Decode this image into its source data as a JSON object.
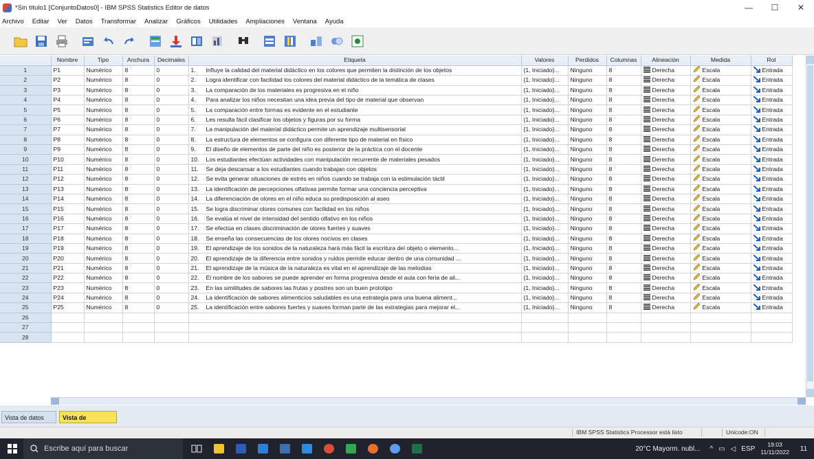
{
  "window": {
    "title": "*Sin título1 [ConjuntoDatos0] - IBM SPSS Statistics Editor de datos",
    "minimize": "—",
    "maximize": "☐",
    "close": "✕"
  },
  "menu": [
    "Archivo",
    "Editar",
    "Ver",
    "Datos",
    "Transformar",
    "Analizar",
    "Gráficos",
    "Utilidades",
    "Ampliaciones",
    "Ventana",
    "Ayuda"
  ],
  "toolbar": {
    "icons": [
      "open-folder-icon",
      "save-icon",
      "print-icon",
      "dialog-recall-icon",
      "undo-icon",
      "redo-icon",
      "goto-case-icon",
      "goto-variable-icon",
      "variables-icon",
      "run-descriptives-icon",
      "find-icon",
      "insert-cases-icon",
      "insert-variable-icon",
      "split-file-icon",
      "weight-cases-icon",
      "select-cases-icon",
      "value-labels-icon"
    ]
  },
  "grid": {
    "headers": [
      "Nombre",
      "Tipo",
      "Anchura",
      "Decimales",
      "Etiqueta",
      "Valores",
      "Perdidos",
      "Columnas",
      "Alineación",
      "Medida",
      "Rol"
    ],
    "rows": [
      {
        "n": "1",
        "nombre": "P1",
        "tipo": "Numérico",
        "anchura": "8",
        "decimales": "0",
        "num": "1.",
        "etiqueta": "Influye la calidad del material didáctico en los colores que permiten la distinción de los objetos",
        "valores": "{1, Iniciado}...",
        "perdidos": "Ninguno",
        "columnas": "8",
        "alineacion": "Derecha",
        "medida": "Escala",
        "rol": "Entrada"
      },
      {
        "n": "2",
        "nombre": "P2",
        "tipo": "Numérico",
        "anchura": "8",
        "decimales": "0",
        "num": "2.",
        "etiqueta": "Logra identificar con facilidad los colores del material didáctico de la temática de clases",
        "valores": "{1, Iniciado}...",
        "perdidos": "Ninguno",
        "columnas": "8",
        "alineacion": "Derecha",
        "medida": "Escala",
        "rol": "Entrada"
      },
      {
        "n": "3",
        "nombre": "P3",
        "tipo": "Numérico",
        "anchura": "8",
        "decimales": "0",
        "num": "3.",
        "etiqueta": "La comparación de los materiales es progresiva en el niño",
        "valores": "{1, Iniciado}...",
        "perdidos": "Ninguno",
        "columnas": "8",
        "alineacion": "Derecha",
        "medida": "Escala",
        "rol": "Entrada"
      },
      {
        "n": "4",
        "nombre": "P4",
        "tipo": "Numérico",
        "anchura": "8",
        "decimales": "0",
        "num": "4.",
        "etiqueta": "Para analizar los niños necesitan una idea previa del tipo de material que observan",
        "valores": "{1, Iniciado}...",
        "perdidos": "Ninguno",
        "columnas": "8",
        "alineacion": "Derecha",
        "medida": "Escala",
        "rol": "Entrada"
      },
      {
        "n": "5",
        "nombre": "P5",
        "tipo": "Numérico",
        "anchura": "8",
        "decimales": "0",
        "num": "5.",
        "etiqueta": "La comparación entre formas es evidente en el estudiante",
        "valores": "{1, Iniciado}...",
        "perdidos": "Ninguno",
        "columnas": "8",
        "alineacion": "Derecha",
        "medida": "Escala",
        "rol": "Entrada"
      },
      {
        "n": "6",
        "nombre": "P6",
        "tipo": "Numérico",
        "anchura": "8",
        "decimales": "0",
        "num": "6.",
        "etiqueta": "Les resulta fácil clasificar los objetos y figuras por su forma",
        "valores": "{1, Iniciado}...",
        "perdidos": "Ninguno",
        "columnas": "8",
        "alineacion": "Derecha",
        "medida": "Escala",
        "rol": "Entrada"
      },
      {
        "n": "7",
        "nombre": "P7",
        "tipo": "Numérico",
        "anchura": "8",
        "decimales": "0",
        "num": "7.",
        "etiqueta": "La manipulación del material didáctico permite un aprendizaje multisensorial",
        "valores": "{1, Iniciado}...",
        "perdidos": "Ninguno",
        "columnas": "8",
        "alineacion": "Derecha",
        "medida": "Escala",
        "rol": "Entrada"
      },
      {
        "n": "8",
        "nombre": "P8",
        "tipo": "Numérico",
        "anchura": "8",
        "decimales": "0",
        "num": "8.",
        "etiqueta": "La estructura de elementos se configura con diferente tipo de material en físico",
        "valores": "{1, Iniciado}...",
        "perdidos": "Ninguno",
        "columnas": "8",
        "alineacion": "Derecha",
        "medida": "Escala",
        "rol": "Entrada"
      },
      {
        "n": "9",
        "nombre": "P9",
        "tipo": "Numérico",
        "anchura": "8",
        "decimales": "0",
        "num": "9.",
        "etiqueta": "El diseño de elementos de parte del niño es posterior de la práctica con el docente",
        "valores": "{1, Iniciado}...",
        "perdidos": "Ninguno",
        "columnas": "8",
        "alineacion": "Derecha",
        "medida": "Escala",
        "rol": "Entrada"
      },
      {
        "n": "10",
        "nombre": "P10",
        "tipo": "Numérico",
        "anchura": "8",
        "decimales": "0",
        "num": "10.",
        "etiqueta": "Los estudiantes efectúan actividades con manipulación recurrente de materiales pesados",
        "valores": "{1, Iniciado}...",
        "perdidos": "Ninguno",
        "columnas": "8",
        "alineacion": "Derecha",
        "medida": "Escala",
        "rol": "Entrada"
      },
      {
        "n": "11",
        "nombre": "P11",
        "tipo": "Numérico",
        "anchura": "8",
        "decimales": "0",
        "num": "11.",
        "etiqueta": "Se deja descansar a los estudiantes cuando trabajan con objetos",
        "valores": "{1, Iniciado}...",
        "perdidos": "Ninguno",
        "columnas": "8",
        "alineacion": "Derecha",
        "medida": "Escala",
        "rol": "Entrada"
      },
      {
        "n": "12",
        "nombre": "P12",
        "tipo": "Numérico",
        "anchura": "8",
        "decimales": "0",
        "num": "12.",
        "etiqueta": "Se evita generar situaciones de estrés en niños cuando se trabaja con la estimulación táctil",
        "valores": "{1, Iniciado}...",
        "perdidos": "Ninguno",
        "columnas": "8",
        "alineacion": "Derecha",
        "medida": "Escala",
        "rol": "Entrada"
      },
      {
        "n": "13",
        "nombre": "P13",
        "tipo": "Numérico",
        "anchura": "8",
        "decimales": "0",
        "num": "13.",
        "etiqueta": "La identificación de percepciones olfativas permite formar una conciencia perceptiva",
        "valores": "{1, Iniciado}...",
        "perdidos": "Ninguno",
        "columnas": "8",
        "alineacion": "Derecha",
        "medida": "Escala",
        "rol": "Entrada"
      },
      {
        "n": "14",
        "nombre": "P14",
        "tipo": "Numérico",
        "anchura": "8",
        "decimales": "0",
        "num": "14.",
        "etiqueta": "La diferenciación de olores en el niño educa su predisposición al aseo",
        "valores": "{1, Iniciado}...",
        "perdidos": "Ninguno",
        "columnas": "8",
        "alineacion": "Derecha",
        "medida": "Escala",
        "rol": "Entrada"
      },
      {
        "n": "15",
        "nombre": "P15",
        "tipo": "Numérico",
        "anchura": "8",
        "decimales": "0",
        "num": "15.",
        "etiqueta": "Se logra discriminar olores comunes con facilidad en los niños",
        "valores": "{1, Iniciado}...",
        "perdidos": "Ninguno",
        "columnas": "8",
        "alineacion": "Derecha",
        "medida": "Escala",
        "rol": "Entrada"
      },
      {
        "n": "16",
        "nombre": "P16",
        "tipo": "Numérico",
        "anchura": "8",
        "decimales": "0",
        "num": "16.",
        "etiqueta": "Se evalúa el nivel de intensidad del sentido olfativo en los niños",
        "valores": "{1, Iniciado}...",
        "perdidos": "Ninguno",
        "columnas": "8",
        "alineacion": "Derecha",
        "medida": "Escala",
        "rol": "Entrada"
      },
      {
        "n": "17",
        "nombre": "P17",
        "tipo": "Numérico",
        "anchura": "8",
        "decimales": "0",
        "num": "17.",
        "etiqueta": "Se efectúa en clases discriminación de olores fuertes y suaves",
        "valores": "{1, Iniciado}...",
        "perdidos": "Ninguno",
        "columnas": "8",
        "alineacion": "Derecha",
        "medida": "Escala",
        "rol": "Entrada"
      },
      {
        "n": "18",
        "nombre": "P18",
        "tipo": "Numérico",
        "anchura": "8",
        "decimales": "0",
        "num": "18.",
        "etiqueta": "Se enseña las consecuencias de los olores nocivos en clases",
        "valores": "{1, Iniciado}...",
        "perdidos": "Ninguno",
        "columnas": "8",
        "alineacion": "Derecha",
        "medida": "Escala",
        "rol": "Entrada"
      },
      {
        "n": "19",
        "nombre": "P19",
        "tipo": "Numérico",
        "anchura": "8",
        "decimales": "0",
        "num": "19.",
        "etiqueta": "El aprendizaje de los sonidos de la naturaleza hará más fácil la escritura del objeto o elemento...",
        "valores": "{1, Iniciado}...",
        "perdidos": "Ninguno",
        "columnas": "8",
        "alineacion": "Derecha",
        "medida": "Escala",
        "rol": "Entrada"
      },
      {
        "n": "20",
        "nombre": "P20",
        "tipo": "Numérico",
        "anchura": "8",
        "decimales": "0",
        "num": "20.",
        "etiqueta": "El aprendizaje de la diferencia entre sonidos y ruidos permite educar dentro de una comunidad ...",
        "valores": "{1, Iniciado}...",
        "perdidos": "Ninguno",
        "columnas": "8",
        "alineacion": "Derecha",
        "medida": "Escala",
        "rol": "Entrada"
      },
      {
        "n": "21",
        "nombre": "P21",
        "tipo": "Numérico",
        "anchura": "8",
        "decimales": "0",
        "num": "21.",
        "etiqueta": "El aprendizaje de la música de la naturaleza es vital en el aprendizaje de las melodías",
        "valores": "{1, Iniciado}...",
        "perdidos": "Ninguno",
        "columnas": "8",
        "alineacion": "Derecha",
        "medida": "Escala",
        "rol": "Entrada"
      },
      {
        "n": "22",
        "nombre": "P22",
        "tipo": "Numérico",
        "anchura": "8",
        "decimales": "0",
        "num": "22.",
        "etiqueta": "El nombre de los sabores se puede aprender en forma progresiva desde el aula con feria de ali...",
        "valores": "{1, Iniciado}...",
        "perdidos": "Ninguno",
        "columnas": "8",
        "alineacion": "Derecha",
        "medida": "Escala",
        "rol": "Entrada"
      },
      {
        "n": "23",
        "nombre": "P23",
        "tipo": "Numérico",
        "anchura": "8",
        "decimales": "0",
        "num": "23.",
        "etiqueta": "En las similitudes de sabores las frutas y postres son un buen prototipo",
        "valores": "{1, Iniciado}...",
        "perdidos": "Ninguno",
        "columnas": "8",
        "alineacion": "Derecha",
        "medida": "Escala",
        "rol": "Entrada"
      },
      {
        "n": "24",
        "nombre": "P24",
        "tipo": "Numérico",
        "anchura": "8",
        "decimales": "0",
        "num": "24.",
        "etiqueta": "La identificación de sabores alimenticios saludables es una estrategia para una buena aliment...",
        "valores": "{1, Iniciado}...",
        "perdidos": "Ninguno",
        "columnas": "8",
        "alineacion": "Derecha",
        "medida": "Escala",
        "rol": "Entrada"
      },
      {
        "n": "25",
        "nombre": "P25",
        "tipo": "Numérico",
        "anchura": "8",
        "decimales": "0",
        "num": "25.",
        "etiqueta": "La identificación entre sabores fuertes y suaves forman parte de las estrategias para mejorar el...",
        "valores": "{1, Iniciado}...",
        "perdidos": "Ninguno",
        "columnas": "8",
        "alineacion": "Derecha",
        "medida": "Escala",
        "rol": "Entrada"
      }
    ],
    "empty_rows": [
      "26",
      "27",
      "28"
    ]
  },
  "tabs": {
    "datos": "Vista de datos",
    "variables": "Vista de variables"
  },
  "status": {
    "processor": "IBM SPSS Statistics Processor está listo",
    "unicode": "Unicode:ON"
  },
  "taskbar": {
    "search_placeholder": "Escribe aquí para buscar",
    "weather": "20°C  Mayorm. nubl...",
    "lang": "ESP",
    "time": "19:03",
    "date": "11/11/2022",
    "notif_count": "11"
  },
  "colors": {
    "header_bg": "#e8eef6",
    "rownum_bg": "#d9e4f2",
    "active_tab": "#f7e25a",
    "taskbar": "#20232c"
  }
}
